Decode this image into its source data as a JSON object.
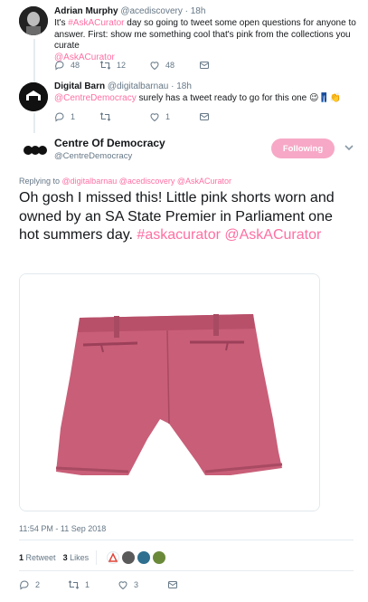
{
  "colors": {
    "brand_pink": "#f7a8c6",
    "link_pink": "#ff6fa3",
    "text": "#14171a",
    "muted": "#657786",
    "divider": "#e6ecf0"
  },
  "tweet1": {
    "name": "Adrian Murphy",
    "handle": "@acediscovery · 18h",
    "text_pre": "It's ",
    "hashtag": "#AskACurator",
    "text_post": " day so going to tweet some open questions for anyone to answer. First: show me something cool that's pink from the collections you curate",
    "mention": "@AskACurator",
    "replies": "48",
    "retweets": "12",
    "likes": "48"
  },
  "tweet2": {
    "name": "Digital Barn",
    "handle": "@digitalbarnau · 18h",
    "mention": "@CentreDemocracy",
    "text_post": " surely has a tweet ready to go for this one 😉👖👏",
    "replies": "1",
    "retweets": "",
    "likes": "1"
  },
  "main": {
    "name": "Centre Of Democracy",
    "handle": "@CentreDemocracy",
    "follow_label": "Following",
    "replying_label": "Replying to ",
    "replying_to": "@digitalbarnau @acediscovery @AskACurator",
    "text": "Oh gosh I missed this! Little pink shorts worn and owned by an SA State Premier in Parliament one hot summers day.",
    "tags": "#askacurator @AskACurator",
    "timestamp": "11:54 PM - 11 Sep 2018",
    "retweets_count": "1",
    "retweets_label": "Retweet",
    "likes_count": "3",
    "likes_label": "Likes",
    "replies": "2",
    "retweets": "1",
    "likes": "3"
  },
  "icons": [
    "reply-icon",
    "retweet-icon",
    "like-icon",
    "dm-icon",
    "chevron-down-icon"
  ]
}
